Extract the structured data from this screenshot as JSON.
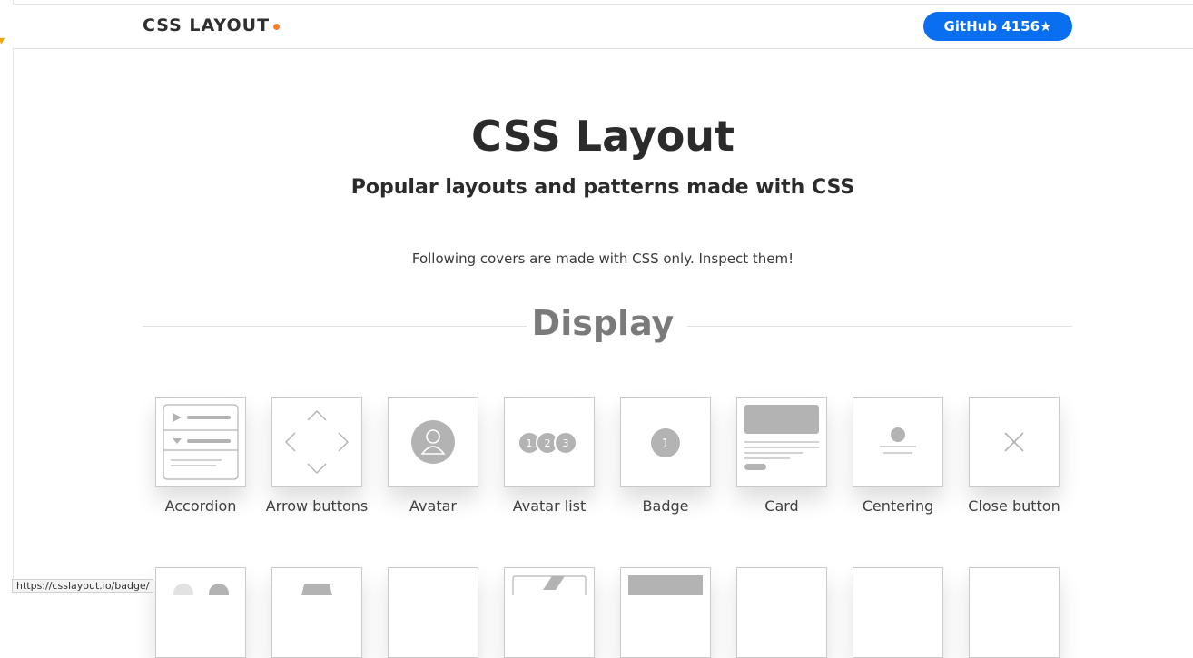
{
  "header": {
    "brand": "CSS LAYOUT",
    "github_button": "GitHub 4156★"
  },
  "hero": {
    "title": "CSS Layout",
    "subtitle": "Popular layouts and patterns made with CSS",
    "note": "Following covers are made with CSS only. Inspect them!"
  },
  "section": {
    "title": "Display"
  },
  "patterns": [
    {
      "label": "Accordion"
    },
    {
      "label": "Arrow buttons"
    },
    {
      "label": "Avatar"
    },
    {
      "label": "Avatar list"
    },
    {
      "label": "Badge"
    },
    {
      "label": "Card"
    },
    {
      "label": "Centering"
    },
    {
      "label": "Close button"
    }
  ],
  "status_bar": {
    "url": "https://csslayout.io/badge/"
  },
  "colors": {
    "accent_blue": "#0a6ef0",
    "brand_dot": "#ff7f27",
    "thumb_gray": "#b3b3b3"
  }
}
